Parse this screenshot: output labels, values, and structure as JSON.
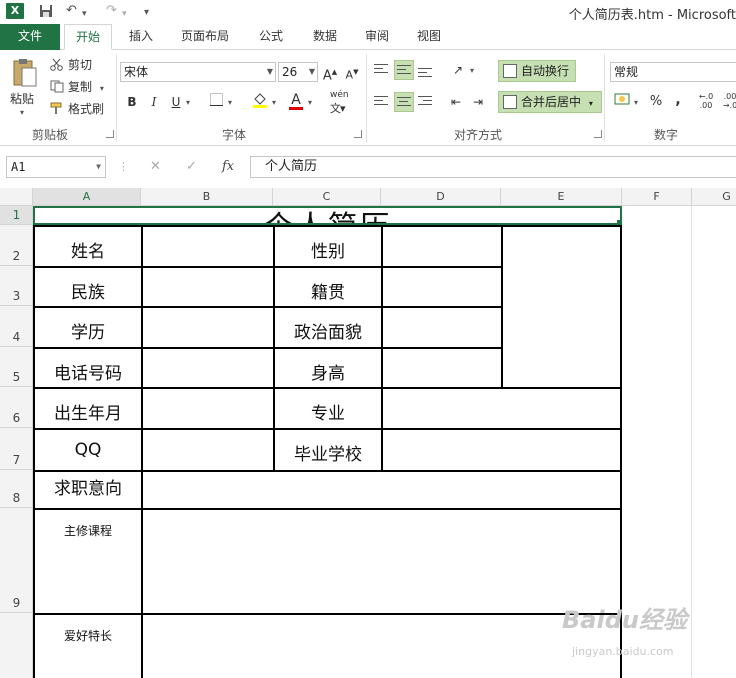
{
  "titlebar": {
    "window_title": "个人简历表.htm - Microsoft",
    "excel_letter": "X"
  },
  "ribbon_tabs": [
    {
      "label": "文件"
    },
    {
      "label": "开始"
    },
    {
      "label": "插入"
    },
    {
      "label": "页面布局"
    },
    {
      "label": "公式"
    },
    {
      "label": "数据"
    },
    {
      "label": "审阅"
    },
    {
      "label": "视图"
    }
  ],
  "clipboard": {
    "paste": "粘贴",
    "cut": "剪切",
    "copy": "复制",
    "format_painter": "格式刷",
    "group_label": "剪贴板"
  },
  "font": {
    "name": "宋体",
    "size": "26",
    "bold": "B",
    "italic": "I",
    "underline": "U",
    "font_color_letter": "A",
    "phonetic": "wén",
    "grow": "A",
    "shrink": "A",
    "group_label": "字体"
  },
  "alignment": {
    "wrap_text": "自动换行",
    "merge_center": "合并后居中",
    "group_label": "对齐方式"
  },
  "number": {
    "format": "常规",
    "percent": "%",
    "comma": ",",
    "group_label": "数字"
  },
  "formula_bar": {
    "cell_ref": "A1",
    "cancel": "✕",
    "confirm": "✓",
    "fx": "fx",
    "content": "个人简历"
  },
  "columns": [
    "A",
    "B",
    "C",
    "D",
    "E",
    "F",
    "G"
  ],
  "rows": [
    "1",
    "2",
    "3",
    "4",
    "5",
    "6",
    "7",
    "8",
    "9"
  ],
  "resume": {
    "title": "个人简历",
    "name": "姓名",
    "gender": "性别",
    "ethnicity": "民族",
    "native_place": "籍贯",
    "education": "学历",
    "political_status": "政治面貌",
    "phone": "电话号码",
    "height": "身高",
    "birth_date": "出生年月",
    "major": "专业",
    "qq": "QQ",
    "graduate_school": "毕业学校",
    "job_intention": "求职意向",
    "main_courses": "主修课程",
    "hobbies": "爱好特长"
  },
  "watermark": {
    "text": "Baidu经验",
    "sub": "jingyan.baidu.com"
  }
}
